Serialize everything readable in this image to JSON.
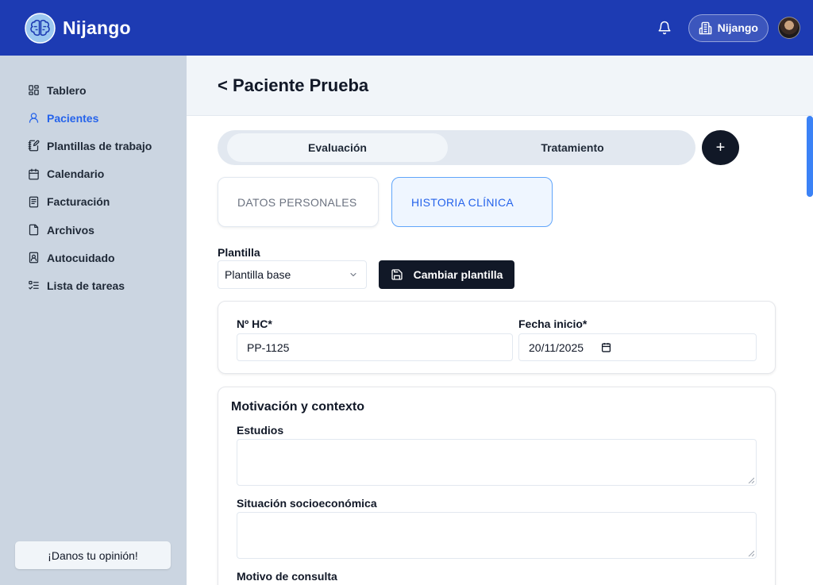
{
  "app": {
    "name": "Nijango",
    "org_label": "Nijango"
  },
  "colors": {
    "header": "#1d3bb3",
    "sidebar": "#cbd5e1",
    "accent": "#2563eb",
    "dark": "#111827"
  },
  "sidebar": {
    "items": [
      {
        "label": "Tablero",
        "icon": "dashboard-icon"
      },
      {
        "label": "Pacientes",
        "icon": "user-icon",
        "active": true
      },
      {
        "label": "Plantillas de trabajo",
        "icon": "notebook-pen-icon"
      },
      {
        "label": "Calendario",
        "icon": "calendar-icon"
      },
      {
        "label": "Facturación",
        "icon": "receipt-icon"
      },
      {
        "label": "Archivos",
        "icon": "file-icon"
      },
      {
        "label": "Autocuidado",
        "icon": "contact-card-icon"
      },
      {
        "label": "Lista de tareas",
        "icon": "list-todo-icon"
      }
    ],
    "feedback_label": "¡Danos tu opinión!"
  },
  "page": {
    "title": "< Paciente Prueba"
  },
  "tabs": [
    {
      "label": "Evaluación",
      "selected": true
    },
    {
      "label": "Tratamiento"
    }
  ],
  "add_button_label": "+",
  "subtabs": [
    {
      "label": "DATOS PERSONALES"
    },
    {
      "label": "HISTORIA CLÍNICA",
      "selected": true
    }
  ],
  "template": {
    "label": "Plantilla",
    "selected": "Plantilla base",
    "change_label": "Cambiar plantilla"
  },
  "record": {
    "hc_label": "Nº HC*",
    "hc_value": "PP-1125",
    "start_label": "Fecha inicio*",
    "start_value": "20/11/2025"
  },
  "motivation": {
    "title": "Motivación y contexto",
    "fields": [
      {
        "label": "Estudios",
        "value": ""
      },
      {
        "label": "Situación socioeconómica",
        "value": ""
      },
      {
        "label": "Motivo de consulta",
        "value": ""
      }
    ]
  }
}
